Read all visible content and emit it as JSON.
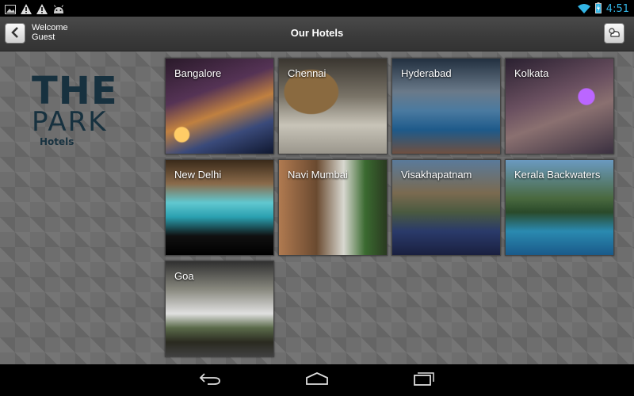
{
  "status_bar": {
    "time": "4:51",
    "icons": [
      "image-icon",
      "warning-icon",
      "warning-icon",
      "android-icon",
      "wifi-icon",
      "battery-charging-icon"
    ]
  },
  "action_bar": {
    "welcome_line1": "Welcome",
    "welcome_line2": "Guest",
    "title": "Our Hotels"
  },
  "logo": {
    "line1": "THE",
    "line2": "PARK",
    "line3": "Hotels"
  },
  "hotels": [
    {
      "name": "Bangalore"
    },
    {
      "name": "Chennai"
    },
    {
      "name": "Hyderabad"
    },
    {
      "name": "Kolkata"
    },
    {
      "name": "New Delhi"
    },
    {
      "name": "Navi Mumbai"
    },
    {
      "name": "Visakhapatnam"
    },
    {
      "name": "Kerala Backwaters"
    },
    {
      "name": "Goa"
    }
  ],
  "colors": {
    "accent": "#33b5e5",
    "logo": "#17313f"
  }
}
